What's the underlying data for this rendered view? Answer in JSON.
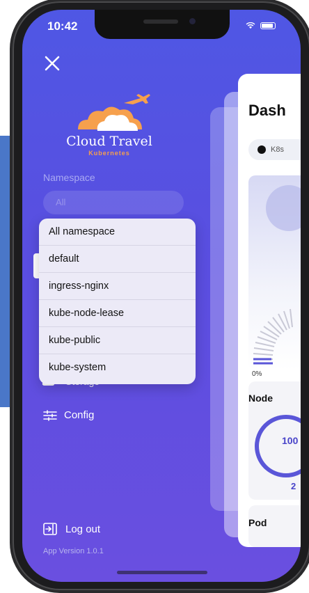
{
  "status_bar": {
    "time": "10:42"
  },
  "brand": {
    "title": "Cloud Travel",
    "subtitle": "Kubernetes"
  },
  "namespace": {
    "label": "Namespace",
    "selected": "All",
    "options": [
      "All namespace",
      "default",
      "ingress-nginx",
      "kube-node-lease",
      "kube-public",
      "kube-system"
    ]
  },
  "menu": {
    "storage": "Storage",
    "config": "Config",
    "logout": "Log out"
  },
  "app_version": "App Version 1.0.1",
  "dashboard": {
    "title": "Dash",
    "cluster_pill": "K8s",
    "gauge_min": "0%",
    "node_title": "Node",
    "node_value": "100",
    "node_sub": "2",
    "pod_title": "Pod"
  },
  "colors": {
    "drawer": "#5a4ee0",
    "accent": "#f6a04d",
    "dropdown": "#eceaf7"
  }
}
